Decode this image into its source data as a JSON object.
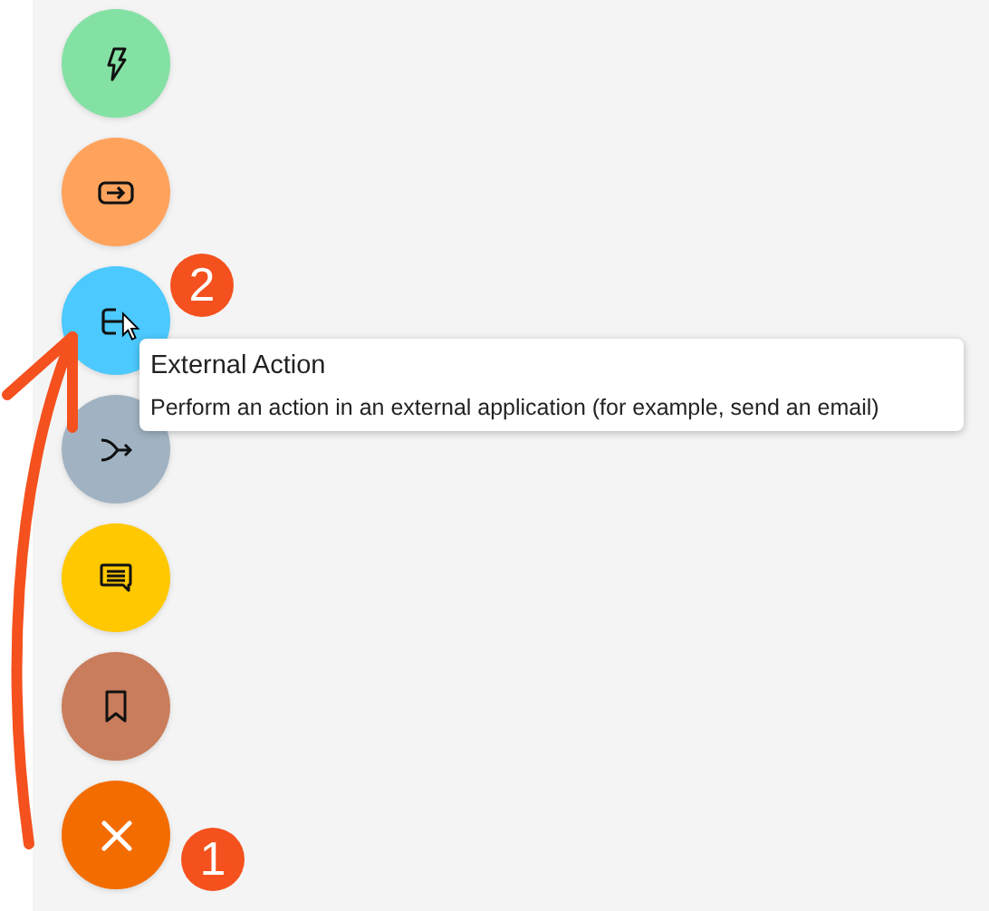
{
  "actions": [
    {
      "kind": "trigger",
      "color": "#84e1a4"
    },
    {
      "kind": "input",
      "color": "#ffa35c"
    },
    {
      "kind": "external",
      "color": "#4cc9fe",
      "badge": "2"
    },
    {
      "kind": "branch",
      "color": "#a1b3c2"
    },
    {
      "kind": "message",
      "color": "#ffc800"
    },
    {
      "kind": "bookmark",
      "color": "#c97d5c"
    },
    {
      "kind": "close",
      "color": "#f36c00",
      "badge": "1"
    }
  ],
  "tooltip": {
    "title": "External Action",
    "description": "Perform an action in an external application (for example, send an email)"
  }
}
